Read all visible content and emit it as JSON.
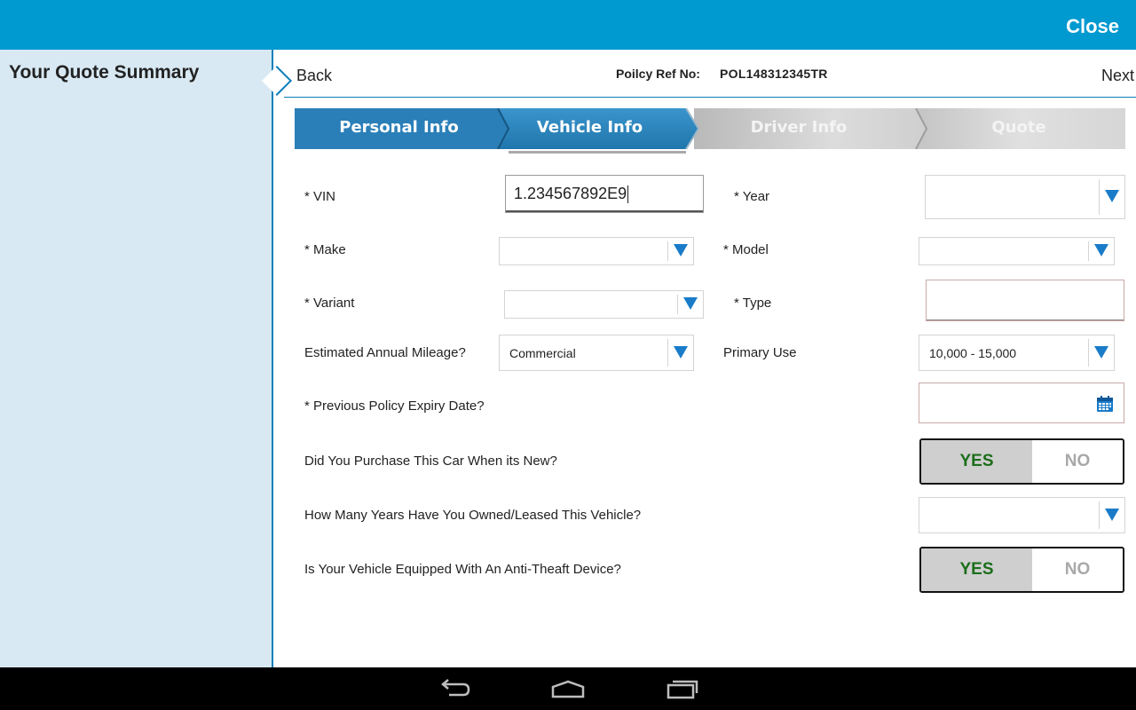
{
  "topbar": {
    "close_label": "Close"
  },
  "sidebar": {
    "title": "Your Quote Summary"
  },
  "header": {
    "back_label": "Back",
    "policy_ref_label": "Poilcy Ref No:",
    "policy_ref_value": "POL148312345TR",
    "next_label": "Next"
  },
  "steps": [
    {
      "label": "Personal Info",
      "state": "completed"
    },
    {
      "label": "Vehicle Info",
      "state": "active"
    },
    {
      "label": "Driver Info",
      "state": "upcoming"
    },
    {
      "label": "Quote",
      "state": "upcoming"
    }
  ],
  "form": {
    "vin": {
      "label": "* VIN",
      "value": "1.234567892E9"
    },
    "year": {
      "label": "* Year",
      "value": ""
    },
    "make": {
      "label": "* Make",
      "value": ""
    },
    "model": {
      "label": "* Model",
      "value": ""
    },
    "variant": {
      "label": "* Variant",
      "value": ""
    },
    "type": {
      "label": "* Type",
      "value": ""
    },
    "mileage": {
      "label": "Estimated Annual Mileage?",
      "value": "Commercial"
    },
    "primary_use": {
      "label": "Primary Use",
      "value": "10,000 - 15,000"
    },
    "expiry_date": {
      "label": "* Previous Policy Expiry Date?",
      "value": ""
    },
    "purchased_new": {
      "label": "Did You Purchase This Car When its New?",
      "yes": "YES",
      "no": "NO",
      "selected": "YES"
    },
    "years_owned": {
      "label": "How Many Years Have You Owned/Leased This Vehicle?",
      "value": ""
    },
    "anti_theft": {
      "label": "Is Your Vehicle Equipped With An Anti-Theaft Device?",
      "yes": "YES",
      "no": "NO",
      "selected": "YES"
    }
  },
  "icons": {
    "calendar": "calendar-icon",
    "dropdown": "chevron-down-icon",
    "nav_back": "back-arrow-icon",
    "nav_home": "home-icon",
    "nav_recents": "recent-apps-icon"
  },
  "colors": {
    "topbar": "#0099d0",
    "sidebar_bg": "#d8e9f3",
    "accent": "#0e7fba",
    "step_active": "#2a86c0",
    "dropdown_arrow": "#1a7cc9",
    "yes_text": "#1b6e1b"
  }
}
